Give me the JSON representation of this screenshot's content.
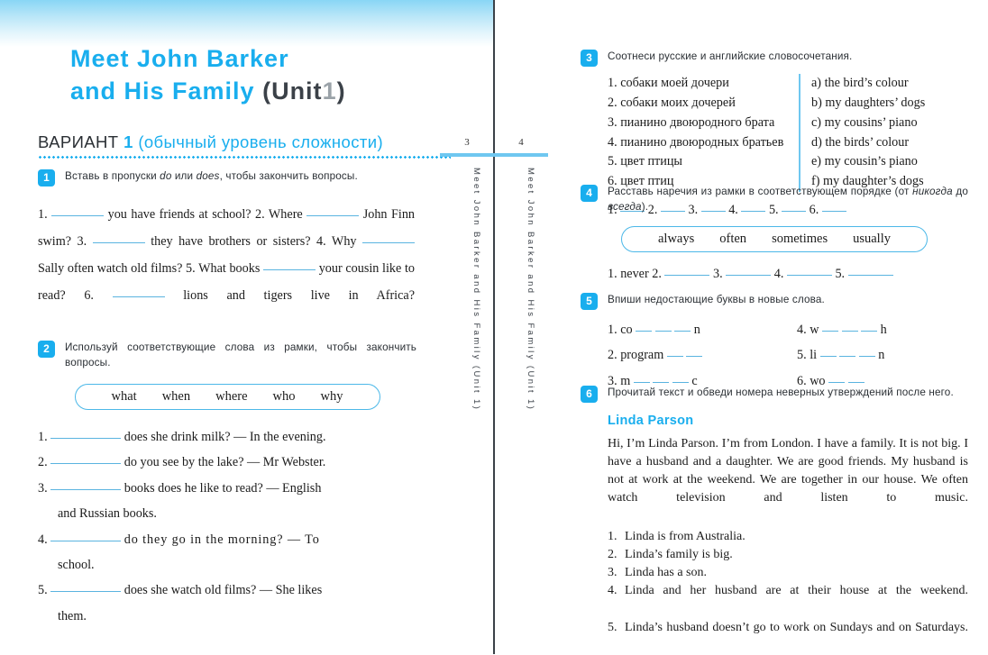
{
  "book": {
    "title_line1": "Meet John Barker",
    "title_line2": "and His Family",
    "unit_open": "(Unit",
    "unit_number": "1",
    "unit_close": ")",
    "running_header_left": "Meet John Barker and His Family (Unit 1)",
    "running_header_right": "Meet John Barker and His Family (Unit 1)",
    "page_left": "3",
    "page_right": "4"
  },
  "variant": {
    "label": "ВАРИАНТ",
    "number": "1",
    "subtitle": "(обычный уровень сложности)"
  },
  "exercises": {
    "ex1": {
      "number": "1",
      "prompt_a": "Вставь в пропуски ",
      "prompt_do": "do",
      "prompt_or": " или ",
      "prompt_does": "does",
      "prompt_b": ", чтобы закончить вопросы.",
      "s1_num": "1.",
      "s1_a": "you have friends at school? 2. Where",
      "s2_a": "John Finn swim? 3.",
      "s2_b": "they have",
      "s3": "brothers or sisters? 4. Why",
      "s3_b": "Sally often watch",
      "s4": "old films? 5. What books",
      "s4_b": "your cousin like to",
      "s5": "read? 6.",
      "s5_b": "lions and tigers live in Africa?"
    },
    "ex2": {
      "number": "2",
      "prompt": "Используй соответствующие слова из рамки, чтобы закончить вопросы.",
      "words": [
        "what",
        "when",
        "where",
        "who",
        "why"
      ],
      "items": [
        {
          "num": "1.",
          "text": "does she drink milk? — In the evening."
        },
        {
          "num": "2.",
          "text": "do you see by the lake? — Mr Webster."
        },
        {
          "num": "3.",
          "text": "books does he like to read? — English",
          "cont": "and Russian books."
        },
        {
          "num": "4.",
          "text": "do they go in the morning? — To",
          "cont": "school."
        },
        {
          "num": "5.",
          "text": "does she watch old films? — She likes",
          "cont": "them."
        }
      ]
    },
    "ex3": {
      "number": "3",
      "prompt": "Соотнеси русские и английские словосочетания.",
      "left": [
        "1. собаки моей дочери",
        "2. собаки моих дочерей",
        "3. пианино двоюродного брата",
        "4. пианино двоюродных братьев",
        "5. цвет птицы",
        "6. цвет птиц"
      ],
      "right": [
        "a) the bird’s colour",
        "b) my daughters’ dogs",
        "c) my cousins’ piano",
        "d) the birds’ colour",
        "e) my cousin’s piano",
        "f) my daughter’s dogs"
      ],
      "answers": [
        "1.",
        "2.",
        "3.",
        "4.",
        "5.",
        "6."
      ]
    },
    "ex4": {
      "number": "4",
      "prompt_a": "Расставь наречия из рамки в соответствующем порядке (от ",
      "prompt_i1": "никогда",
      "prompt_b": " до ",
      "prompt_i2": "всегда",
      "prompt_c": ").",
      "words": [
        "always",
        "often",
        "sometimes",
        "usually"
      ],
      "answer_first_num": "1.",
      "answer_first_word": "never",
      "answer_rest": [
        "2.",
        "3.",
        "4.",
        "5."
      ]
    },
    "ex5": {
      "number": "5",
      "prompt": "Впиши недостающие буквы в новые слова.",
      "left": [
        {
          "num": "1.",
          "pre": "co",
          "blanks": 3,
          "post": "n"
        },
        {
          "num": "2.",
          "pre": "program",
          "blanks": 2,
          "post": ""
        },
        {
          "num": "3.",
          "pre": "m",
          "blanks": 3,
          "post": "c"
        }
      ],
      "right": [
        {
          "num": "4.",
          "pre": "w",
          "blanks": 3,
          "post": "h"
        },
        {
          "num": "5.",
          "pre": "li",
          "blanks": 3,
          "post": "n"
        },
        {
          "num": "6.",
          "pre": "wo",
          "blanks": 2,
          "post": ""
        }
      ]
    },
    "ex6": {
      "number": "6",
      "prompt": "Прочитай текст и обведи номера неверных утверждений после него.",
      "text_title": "Linda Parson",
      "text_body": "Hi, I’m Linda Parson. I’m from London. I have a family. It is not big. I have a husband and a daughter. We are good friends. My husband is not at work at the weekend. We are together in our house. We often watch television and listen to music.",
      "statements": [
        {
          "num": "1.",
          "text": "Linda is from Australia."
        },
        {
          "num": "2.",
          "text": "Linda’s family is big."
        },
        {
          "num": "3.",
          "text": "Linda has a son."
        },
        {
          "num": "4.",
          "text": "Linda and her husband are at their house at the weekend."
        },
        {
          "num": "5.",
          "text": "Linda’s husband doesn’t go to work on Sundays and on Saturdays."
        }
      ]
    }
  },
  "colors": {
    "accent": "#19aeee",
    "rule": "#6fc7f0",
    "blank": "#5ab4e0",
    "ink": "#1b1b1b"
  }
}
